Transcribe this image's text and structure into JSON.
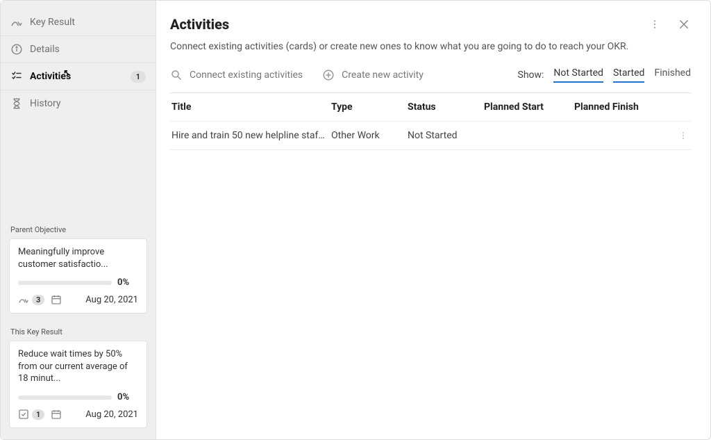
{
  "sidebar": {
    "nav": [
      {
        "label": "Key Result",
        "icon": "path-arrow-icon"
      },
      {
        "label": "Details",
        "icon": "info-icon"
      },
      {
        "label": "Activities",
        "icon": "checklist-icon",
        "badge": "1",
        "selected": true
      },
      {
        "label": "History",
        "icon": "hourglass-icon"
      }
    ],
    "parentObjective": {
      "sectionLabel": "Parent Objective",
      "title": "Meaningfully improve customer satisfactio...",
      "progress": "0%",
      "childCount": "3",
      "date": "Aug 20, 2021"
    },
    "thisKeyResult": {
      "sectionLabel": "This Key Result",
      "title": "Reduce wait times by 50% from our current average of 18 minut...",
      "progress": "0%",
      "childCount": "1",
      "date": "Aug 20, 2021"
    }
  },
  "main": {
    "title": "Activities",
    "subtitle": "Connect existing activities (cards) or create new ones to know what you are going to do to reach your OKR.",
    "actions": {
      "connect": "Connect existing activities",
      "create": "Create new activity"
    },
    "filters": {
      "label": "Show:",
      "options": [
        "Not Started",
        "Started",
        "Finished"
      ],
      "activeIndexes": [
        0,
        1
      ]
    },
    "columns": {
      "title": "Title",
      "type": "Type",
      "status": "Status",
      "plannedStart": "Planned Start",
      "plannedFinish": "Planned Finish"
    },
    "rows": [
      {
        "title": "Hire and train 50 new helpline staff...",
        "type": "Other Work",
        "status": "Not Started",
        "plannedStart": "",
        "plannedFinish": ""
      }
    ]
  }
}
